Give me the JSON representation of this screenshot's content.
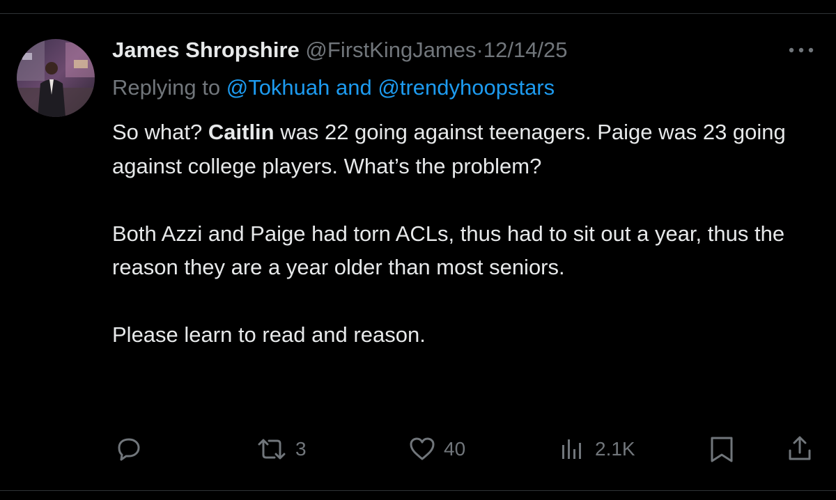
{
  "tweet": {
    "display_name": "James Shropshire",
    "handle": "@FirstKingJames",
    "separator": "·",
    "date": "12/14/25",
    "replying_prefix": "Replying to ",
    "mention_1": "@Tokhuah",
    "mention_joiner": " and ",
    "mention_2": "@trendyhoopstars",
    "para1_start": "So what? ",
    "para1_bold": "Caitlin",
    "para1_end": " was 22 going against teenagers. Paige was 23 going against college players. What’s the problem?",
    "para2": "Both Azzi and Paige had torn ACLs, thus had to sit out a year, thus the reason they are a year older than most seniors.",
    "para3": "Please learn to read and reason."
  },
  "actions": {
    "reply_icon": "reply-icon",
    "retweet_icon": "retweet-icon",
    "retweet_count": "3",
    "like_icon": "heart-icon",
    "like_count": "40",
    "views_icon": "views-icon",
    "views_count": "2.1K",
    "bookmark_icon": "bookmark-icon",
    "share_icon": "share-icon"
  },
  "colors": {
    "background": "#000000",
    "text_primary": "#e7e9ea",
    "text_secondary": "#71767b",
    "link": "#1d9bf0",
    "divider": "#2f3336"
  }
}
